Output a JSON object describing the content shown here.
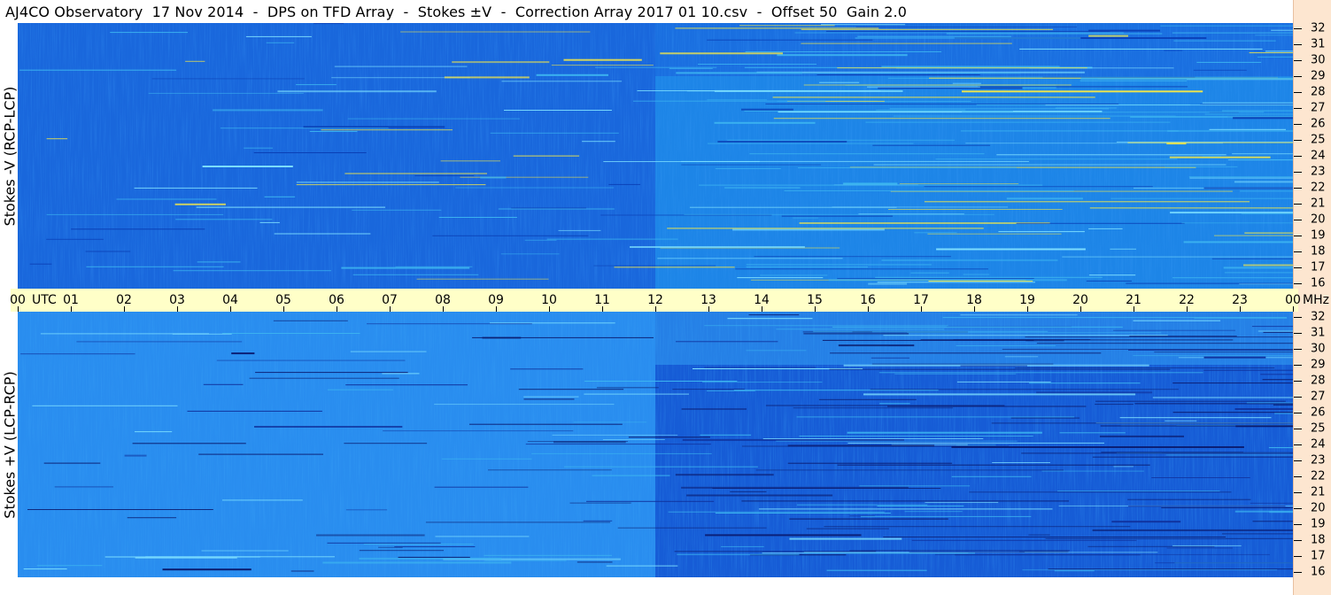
{
  "title": "AJ4CO Observatory  17 Nov 2014  -  DPS on TFD Array  -  Stokes ±V  -  Correction Array 2017 01 10.csv  -  Offset 50  Gain 2.0",
  "chart_data": [
    {
      "type": "heatmap",
      "panel": "top",
      "ylabel": "Stokes -V (RCP-LCP)",
      "y_unit": "MHz",
      "y_ticks": [
        "32",
        "31",
        "30",
        "29",
        "28",
        "27",
        "26",
        "25",
        "24",
        "23",
        "22",
        "21",
        "20",
        "19",
        "18",
        "17",
        "16"
      ],
      "ylim": [
        16,
        32
      ],
      "x_ticks": [
        "00",
        "01",
        "02",
        "03",
        "04",
        "05",
        "06",
        "07",
        "08",
        "09",
        "10",
        "11",
        "12",
        "13",
        "14",
        "15",
        "16",
        "17",
        "18",
        "19",
        "20",
        "21",
        "22",
        "23",
        "00"
      ],
      "x_unit": "UTC",
      "xlim": [
        "00",
        "00"
      ],
      "colors": {
        "background": "#1a72e6",
        "low": "#0a3fb5",
        "mid": "#3cb4f0",
        "high": "#f0e64a",
        "peak": "#f04a2a"
      }
    },
    {
      "type": "heatmap",
      "panel": "bottom",
      "ylabel": "Stokes +V (LCP-RCP)",
      "y_unit": "MHz",
      "y_ticks": [
        "32",
        "31",
        "30",
        "29",
        "28",
        "27",
        "26",
        "25",
        "24",
        "23",
        "22",
        "21",
        "20",
        "19",
        "18",
        "17",
        "16"
      ],
      "ylim": [
        16,
        32
      ],
      "x_ticks": [
        "00",
        "01",
        "02",
        "03",
        "04",
        "05",
        "06",
        "07",
        "08",
        "09",
        "10",
        "11",
        "12",
        "13",
        "14",
        "15",
        "16",
        "17",
        "18",
        "19",
        "20",
        "21",
        "22",
        "23",
        "00"
      ],
      "x_unit": "UTC",
      "xlim": [
        "00",
        "00"
      ],
      "colors": {
        "background": "#1a72e6",
        "low": "#0a1a6e",
        "mid": "#3cb4f0",
        "high": "#f0e64a"
      }
    }
  ],
  "time_axis": {
    "utc_label": "UTC",
    "mhz_label": "MHz"
  }
}
